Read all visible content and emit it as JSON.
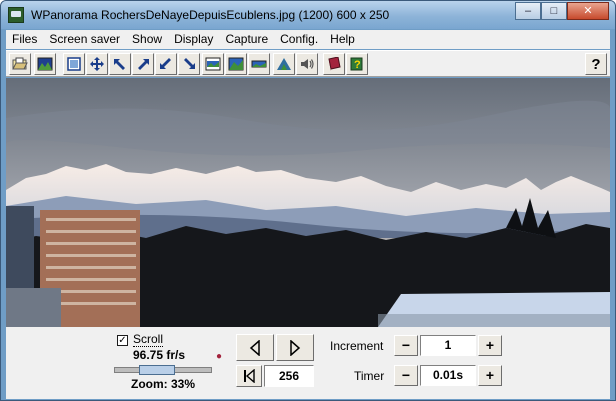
{
  "window": {
    "title": "WPanorama  RochersDeNayeDepuisEcublens.jpg  (1200) 600 x 250",
    "minimize_glyph": "‒",
    "maximize_glyph": "□",
    "close_glyph": "✕"
  },
  "menu": [
    "Files",
    "Screen saver",
    "Show",
    "Display",
    "Capture",
    "Config.",
    "Help"
  ],
  "toolbar": {
    "icons": [
      "open-file-icon",
      "picture-icon",
      "fit-window-icon",
      "move-icon",
      "arrow-up-left-icon",
      "arrow-up-right-icon",
      "arrow-down-left-icon",
      "arrow-down-right-icon",
      "panorama-a-icon",
      "panorama-b-icon",
      "panorama-c-icon",
      "mountain-sound-icon",
      "speaker-icon",
      "book-icon",
      "help-book-icon"
    ],
    "help_label": "?"
  },
  "controls": {
    "scroll_label": "Scroll",
    "scroll_checked": true,
    "scroll_check_glyph": "✓",
    "speed": "96.75 fr/s",
    "zoom": "Zoom: 33%",
    "zoom_fraction": 0.33,
    "position_value": "256",
    "increment_label": "Increment",
    "increment_value": "1",
    "timer_label": "Timer",
    "timer_value": "0.01s",
    "minus_glyph": "−",
    "plus_glyph": "+"
  },
  "colors": {
    "sky_top": "#6f7783",
    "sky_bottom": "#cfc5bc",
    "snow": "#f2e6e2",
    "mountain_shadow": "#8d9db8",
    "forest": "#14161a",
    "roof": "#c8d6ea",
    "building": "#a36f57"
  }
}
